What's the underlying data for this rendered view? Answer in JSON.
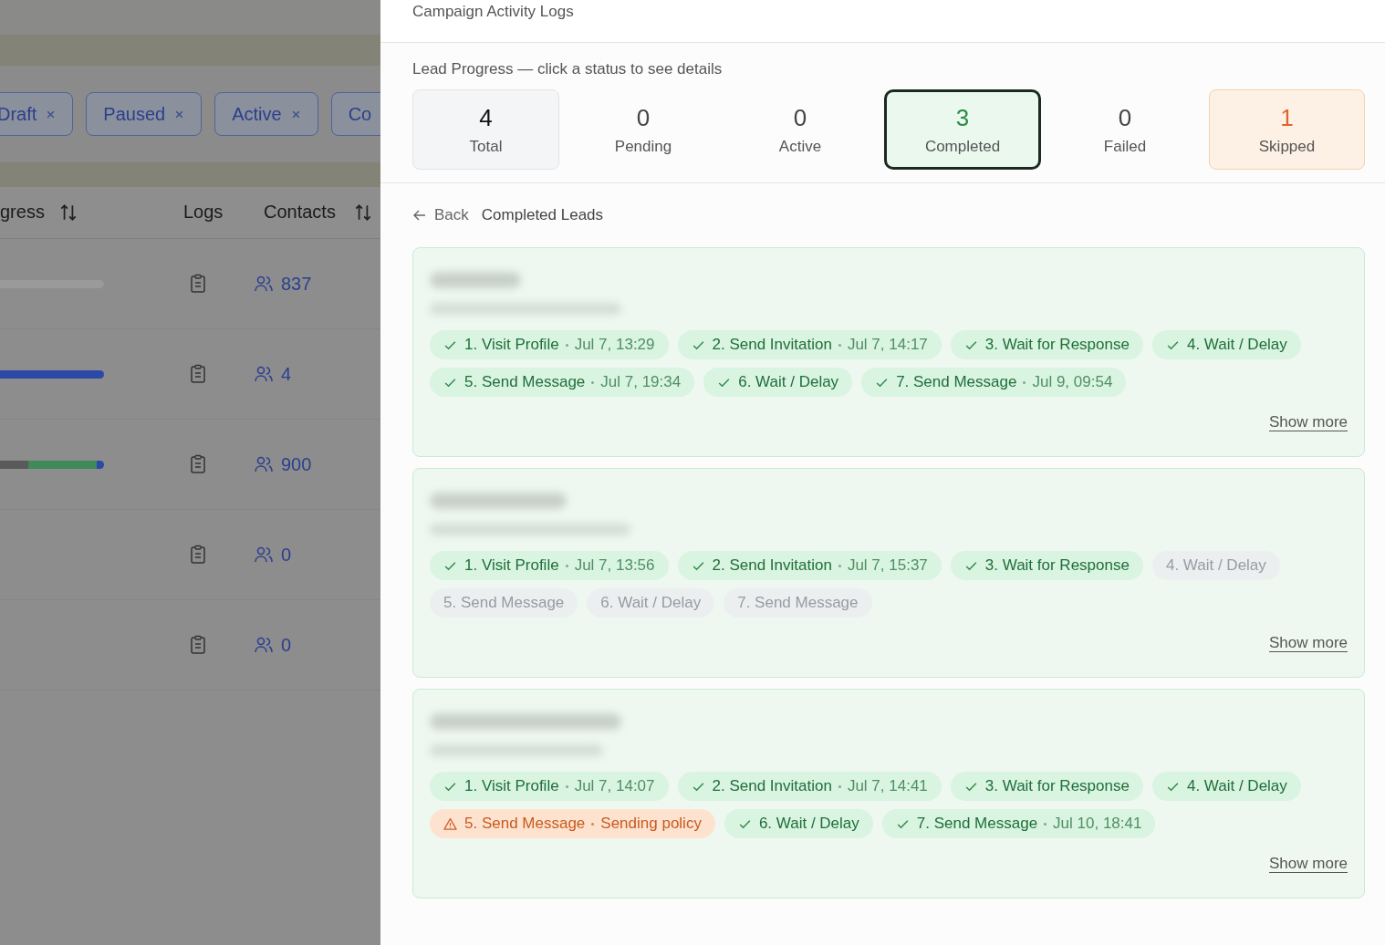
{
  "backdrop": {
    "filters": [
      {
        "label": "Draft"
      },
      {
        "label": "Paused"
      },
      {
        "label": "Active"
      },
      {
        "label": "Co"
      }
    ],
    "columns": [
      {
        "label": "gress",
        "sortable": true
      },
      {
        "label": "Logs",
        "sortable": false
      },
      {
        "label": "Contacts",
        "sortable": true
      }
    ],
    "rows": [
      {
        "progress": [
          {
            "level": 1,
            "color": "#9a9a9a"
          }
        ],
        "contacts": "837"
      },
      {
        "progress": [
          {
            "level": 1,
            "color": "#2c49a8"
          }
        ],
        "contacts": "4"
      },
      {
        "progress": [
          {
            "level": 0.27,
            "color": "#5a5a5a"
          },
          {
            "level": 0.93,
            "color": "#3f8a58"
          },
          {
            "level": 1,
            "color": "#2c49a8"
          }
        ],
        "contacts": "900"
      },
      {
        "contacts": "0"
      },
      {
        "contacts": "0"
      }
    ]
  },
  "panel": {
    "title": "Campaign Activity Logs",
    "progress_label": "Lead Progress — click a status to see details",
    "stats": [
      {
        "value": "4",
        "label": "Total",
        "kind": "total",
        "selected": false
      },
      {
        "value": "0",
        "label": "Pending",
        "kind": "plain",
        "selected": false
      },
      {
        "value": "0",
        "label": "Active",
        "kind": "plain",
        "selected": false
      },
      {
        "value": "3",
        "label": "Completed",
        "kind": "success",
        "selected": true
      },
      {
        "value": "0",
        "label": "Failed",
        "kind": "plain",
        "selected": false
      },
      {
        "value": "1",
        "label": "Skipped",
        "kind": "warning",
        "selected": false
      }
    ],
    "back": "Back",
    "section_title": "Completed Leads",
    "leads": [
      {
        "steps": [
          {
            "kind": "done",
            "label": "1. Visit Profile",
            "detail": "Jul 7, 13:29"
          },
          {
            "kind": "done",
            "label": "2. Send Invitation",
            "detail": "Jul 7, 14:17"
          },
          {
            "kind": "done",
            "label": "3. Wait for Response"
          },
          {
            "kind": "done",
            "label": "4. Wait / Delay"
          },
          {
            "kind": "done",
            "label": "5. Send Message",
            "detail": "Jul 7, 19:34"
          },
          {
            "kind": "done",
            "label": "6. Wait / Delay"
          },
          {
            "kind": "done",
            "label": "7. Send Message",
            "detail": "Jul 9, 09:54"
          }
        ],
        "more": "Show more"
      },
      {
        "steps": [
          {
            "kind": "done",
            "label": "1. Visit Profile",
            "detail": "Jul 7, 13:56"
          },
          {
            "kind": "done",
            "label": "2. Send Invitation",
            "detail": "Jul 7, 15:37"
          },
          {
            "kind": "done",
            "label": "3. Wait for Response"
          },
          {
            "kind": "pending",
            "label": "4. Wait / Delay"
          },
          {
            "kind": "pending",
            "label": "5. Send Message"
          },
          {
            "kind": "pending",
            "label": "6. Wait / Delay"
          },
          {
            "kind": "pending",
            "label": "7. Send Message"
          }
        ],
        "more": "Show more"
      },
      {
        "steps": [
          {
            "kind": "done",
            "label": "1. Visit Profile",
            "detail": "Jul 7, 14:07"
          },
          {
            "kind": "done",
            "label": "2. Send Invitation",
            "detail": "Jul 7, 14:41"
          },
          {
            "kind": "done",
            "label": "3. Wait for Response"
          },
          {
            "kind": "done",
            "label": "4. Wait / Delay"
          },
          {
            "kind": "warning",
            "label": "5. Send Message",
            "detail": "Sending policy"
          },
          {
            "kind": "done",
            "label": "6. Wait / Delay"
          },
          {
            "kind": "done",
            "label": "7. Send Message",
            "detail": "Jul 10, 18:41"
          }
        ],
        "more": "Show more"
      }
    ]
  }
}
